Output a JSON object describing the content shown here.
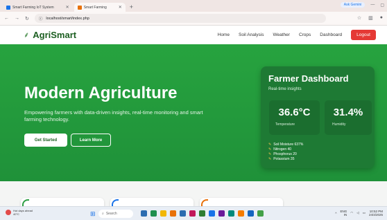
{
  "browser": {
    "tabs": [
      {
        "title": "Smart Farming IoT System",
        "active": false,
        "color": "#1a73e8"
      },
      {
        "title": "Smart Farming",
        "active": true,
        "color": "#e8710a"
      }
    ],
    "new_tab_icon": "plus-icon",
    "gemini_label": "Ask Gemini",
    "url": "localhost/smart/index.php"
  },
  "nav": {
    "logo_icon": "plant-icon",
    "logo_text": "AgriSmart",
    "links": [
      "Home",
      "Soil Analysis",
      "Weather",
      "Crops",
      "Dashboard"
    ],
    "logout_label": "Logout"
  },
  "hero": {
    "title": "Modern Agriculture",
    "subtitle": "Empowering farmers with data-driven insights, real-time monitoring and smart farming technology.",
    "start_label": "Get Started",
    "learn_label": "Learn More"
  },
  "dashboard": {
    "title": "Farmer Dashboard",
    "subtitle": "Real-time insights",
    "temperature": {
      "value": "36.6°C",
      "label": "Temperature"
    },
    "humidity": {
      "value": "31.4%",
      "label": "Humidity"
    },
    "readings": [
      {
        "icon": "droplet-icon",
        "text": "Soil Moisture 637%"
      },
      {
        "icon": "leaf-icon",
        "text": "Nitrogen 40"
      },
      {
        "icon": "leaf-icon",
        "text": "Phosphorus 20"
      },
      {
        "icon": "leaf-icon",
        "text": "Potassium 35"
      }
    ]
  },
  "cards_accents": [
    "#2e9e44",
    "#1a73e8",
    "#e8710a"
  ],
  "taskbar": {
    "weather_line1": "Hot days ahead",
    "weather_line2": "40°C",
    "search_placeholder": "Search",
    "lang_line1": "ENG",
    "lang_line2": "IN",
    "time": "10:52 PM",
    "date": "24/4/2025",
    "app_colors": [
      "#2b6cb0",
      "#1f8f4e",
      "#f2b705",
      "#e8710a",
      "#2b6cb0",
      "#c2185b",
      "#2e7d32",
      "#1a73e8",
      "#6a1b9a",
      "#00897b",
      "#f57c00",
      "#1565c0",
      "#43a047"
    ]
  }
}
